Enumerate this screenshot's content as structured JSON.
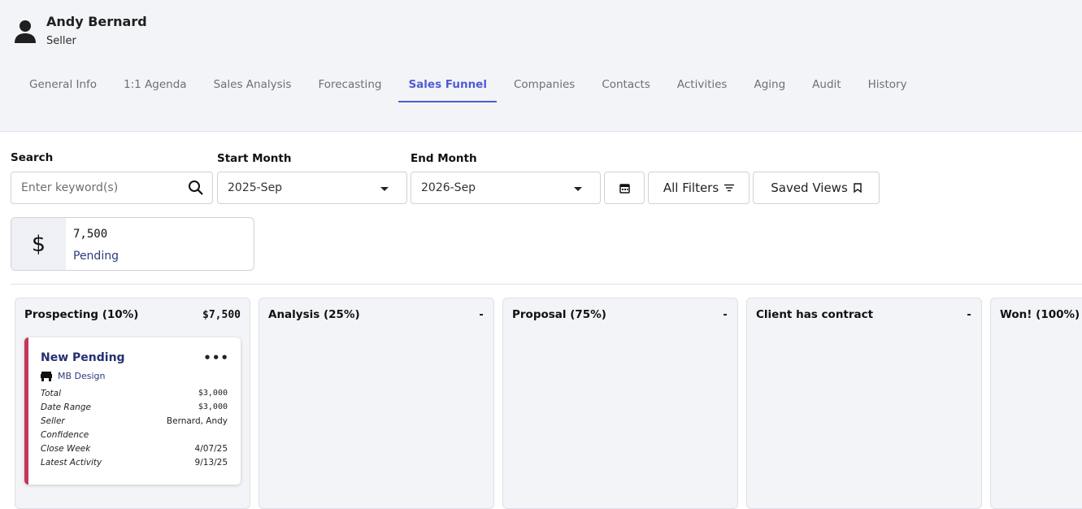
{
  "user": {
    "name": "Andy Bernard",
    "role": "Seller"
  },
  "tabs": [
    {
      "label": "General Info"
    },
    {
      "label": "1:1 Agenda"
    },
    {
      "label": "Sales Analysis"
    },
    {
      "label": "Forecasting"
    },
    {
      "label": "Sales Funnel",
      "active": true
    },
    {
      "label": "Companies"
    },
    {
      "label": "Contacts"
    },
    {
      "label": "Activities"
    },
    {
      "label": "Aging"
    },
    {
      "label": "Audit"
    },
    {
      "label": "History"
    }
  ],
  "filters": {
    "search_label": "Search",
    "search_placeholder": "Enter keyword(s)",
    "start_label": "Start Month",
    "start_value": "2025-Sep",
    "end_label": "End Month",
    "end_value": "2026-Sep",
    "all_filters_label": "All Filters",
    "saved_views_label": "Saved Views"
  },
  "summary": {
    "icon": "$",
    "value": "7,500",
    "status": "Pending"
  },
  "columns": [
    {
      "title": "Prospecting (10%)",
      "total": "$7,500"
    },
    {
      "title": "Analysis (25%)",
      "total": "-"
    },
    {
      "title": "Proposal (75%)",
      "total": "-"
    },
    {
      "title": "Client has contract",
      "total": "-"
    },
    {
      "title": "Won! (100%)",
      "total": ""
    }
  ],
  "card": {
    "title": "New Pending",
    "menu": "•••",
    "company": "MB Design",
    "accent": "#c4365a",
    "rows": [
      {
        "key": "Total",
        "value": "$3,000"
      },
      {
        "key": "Date Range",
        "value": "$3,000"
      },
      {
        "key": "Seller",
        "value": "Bernard, Andy"
      },
      {
        "key": "Confidence",
        "value": ""
      },
      {
        "key": "Close Week",
        "value": "4/07/25"
      },
      {
        "key": "Latest Activity",
        "value": "9/13/25"
      }
    ]
  }
}
